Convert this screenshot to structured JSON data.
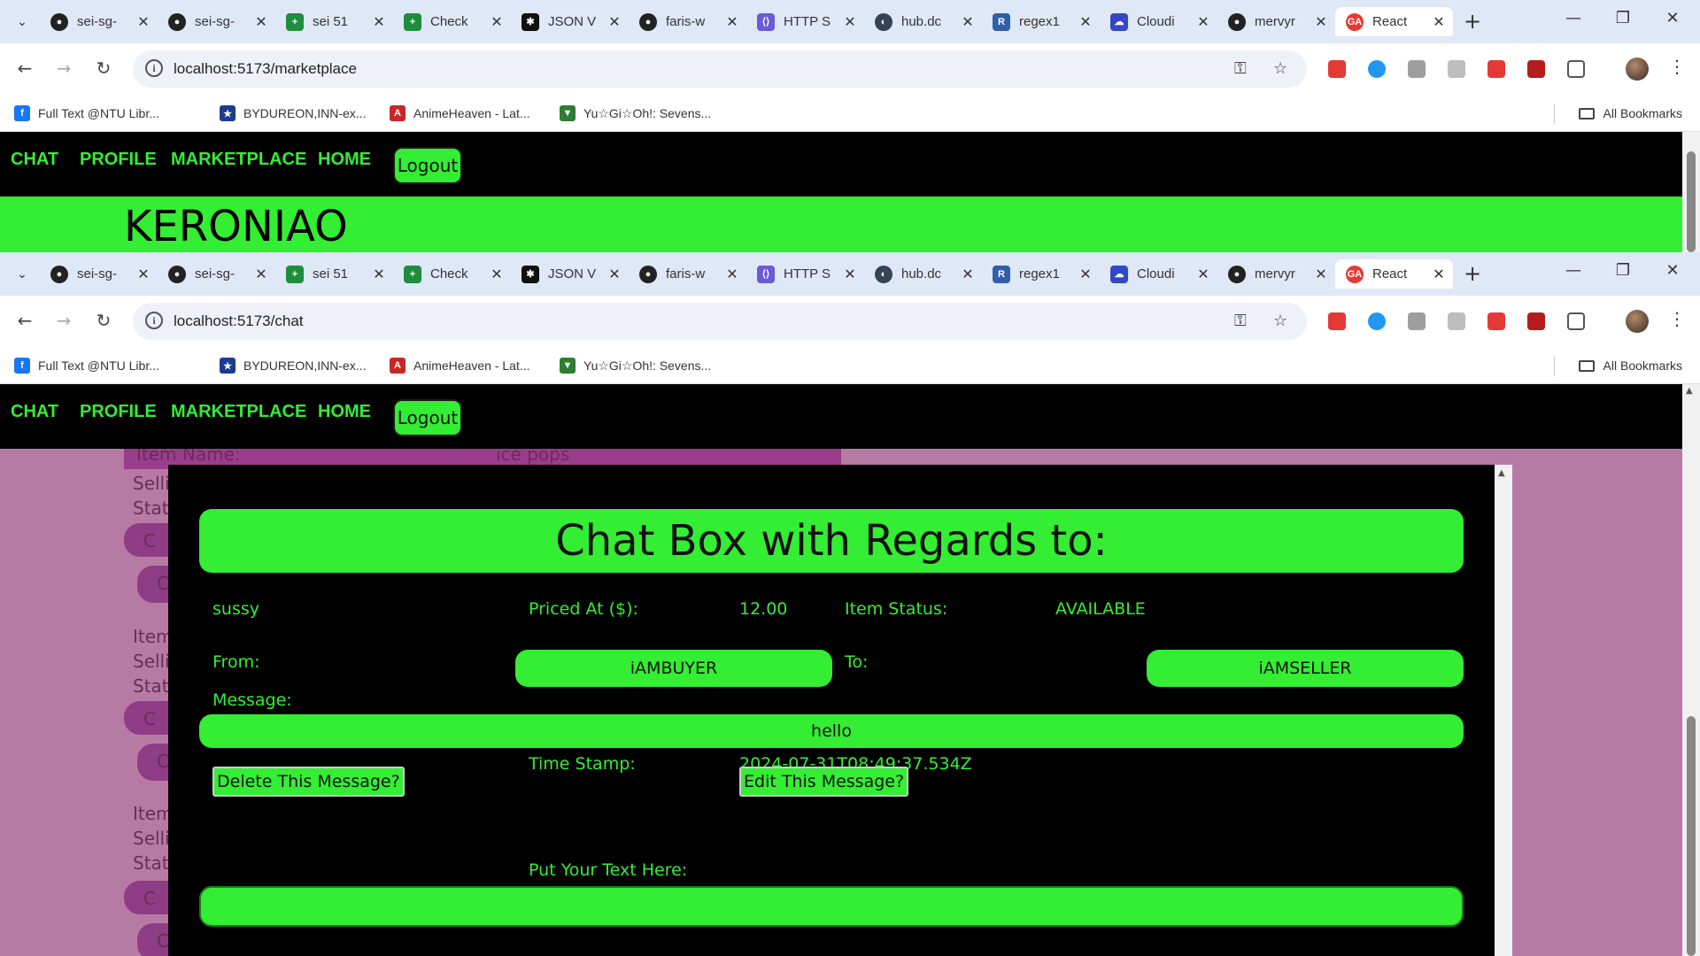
{
  "browser": {
    "tabs": [
      {
        "title": "sei-sg-",
        "icon": "github-icon"
      },
      {
        "title": "sei-sg-",
        "icon": "github-icon"
      },
      {
        "title": "sei 51",
        "icon": "sheets-icon"
      },
      {
        "title": "Check",
        "icon": "sheets-icon"
      },
      {
        "title": "JSON V",
        "icon": "json-icon"
      },
      {
        "title": "faris-w",
        "icon": "github-icon"
      },
      {
        "title": "HTTP S",
        "icon": "http-icon"
      },
      {
        "title": "hub.dc",
        "icon": "docker-icon"
      },
      {
        "title": "regex1",
        "icon": "regex-icon"
      },
      {
        "title": "Cloudi",
        "icon": "cloudinary-icon"
      },
      {
        "title": "mervyr",
        "icon": "github-icon"
      },
      {
        "title": "React",
        "icon": "react-ga-icon"
      }
    ],
    "bookmarks": [
      {
        "label": "Full Text @NTU Libr...",
        "icon": "facebook-icon"
      },
      {
        "label": "BYDUREON,INN-ex...",
        "icon": "eu-flag-icon"
      },
      {
        "label": "AnimeHeaven - Lat...",
        "icon": "animeheaven-icon"
      },
      {
        "label": "Yu☆Gi☆Oh!: Sevens...",
        "icon": "yugioh-icon"
      }
    ],
    "all_bookmarks": "All Bookmarks",
    "url_back": "localhost:5173/marketplace",
    "url_front": "localhost:5173/chat",
    "colors": {
      "accent": "#33ee33",
      "page_bg": "#b77aa5",
      "tabstrip": "#dfe8f6"
    }
  },
  "nav": {
    "links": [
      "CHAT",
      "PROFILE",
      "MARKETPLACE",
      "HOME"
    ],
    "logout": "Logout"
  },
  "marketplace": {
    "banner": "KERONIAO",
    "bg_item_label": "Item Name:",
    "bg_item_value": "ice pops",
    "bg_labels": [
      "Item",
      "Selli",
      "Stat"
    ],
    "bg_btn_prefixes": [
      "C",
      "Che"
    ]
  },
  "chat": {
    "header": "Chat Box with Regards to:",
    "item_name": "sussy",
    "priced_label": "Priced At ($):",
    "price": "12.00",
    "status_label": "Item Status:",
    "status": "AVAILABLE",
    "from_label": "From:",
    "from": "iAMBUYER",
    "to_label": "To:",
    "to": "iAMSELLER",
    "message_label": "Message:",
    "message": "hello",
    "timestamp_label": "Time Stamp:",
    "timestamp": "2024-07-31T08:49:37.534Z",
    "delete_btn": "Delete This Message?",
    "edit_btn": "Edit This Message?",
    "input_label": "Put Your Text Here:",
    "input_value": ""
  }
}
